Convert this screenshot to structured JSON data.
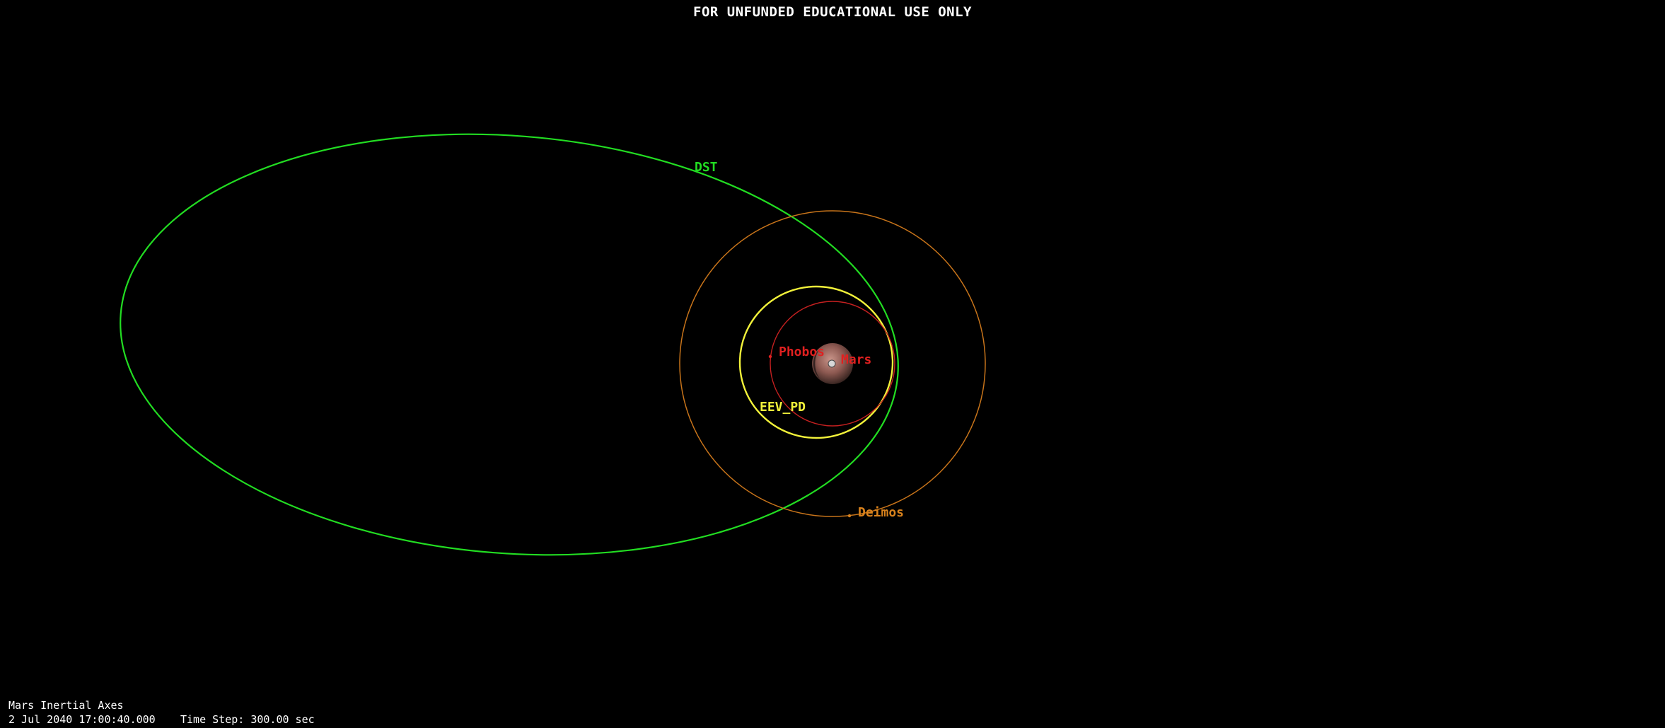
{
  "banner": "FOR UNFUNDED EDUCATIONAL USE ONLY",
  "hud": {
    "reference_frame": "Mars Inertial Axes",
    "datetime": "2 Jul 2040 17:00:40.000",
    "time_step": "Time Step: 300.00 sec"
  },
  "objects": {
    "dst": {
      "label": "DST",
      "color": "#22dd22"
    },
    "eev_pd": {
      "label": "EEV_PD",
      "color": "#f2f23a"
    },
    "phobos": {
      "label": "Phobos",
      "color": "#e02020"
    },
    "mars": {
      "label": "Mars",
      "color": "#e02020"
    },
    "deimos": {
      "label": "Deimos",
      "color": "#d9821c"
    }
  },
  "colors": {
    "background": "#000000",
    "text": "#ffffff"
  }
}
